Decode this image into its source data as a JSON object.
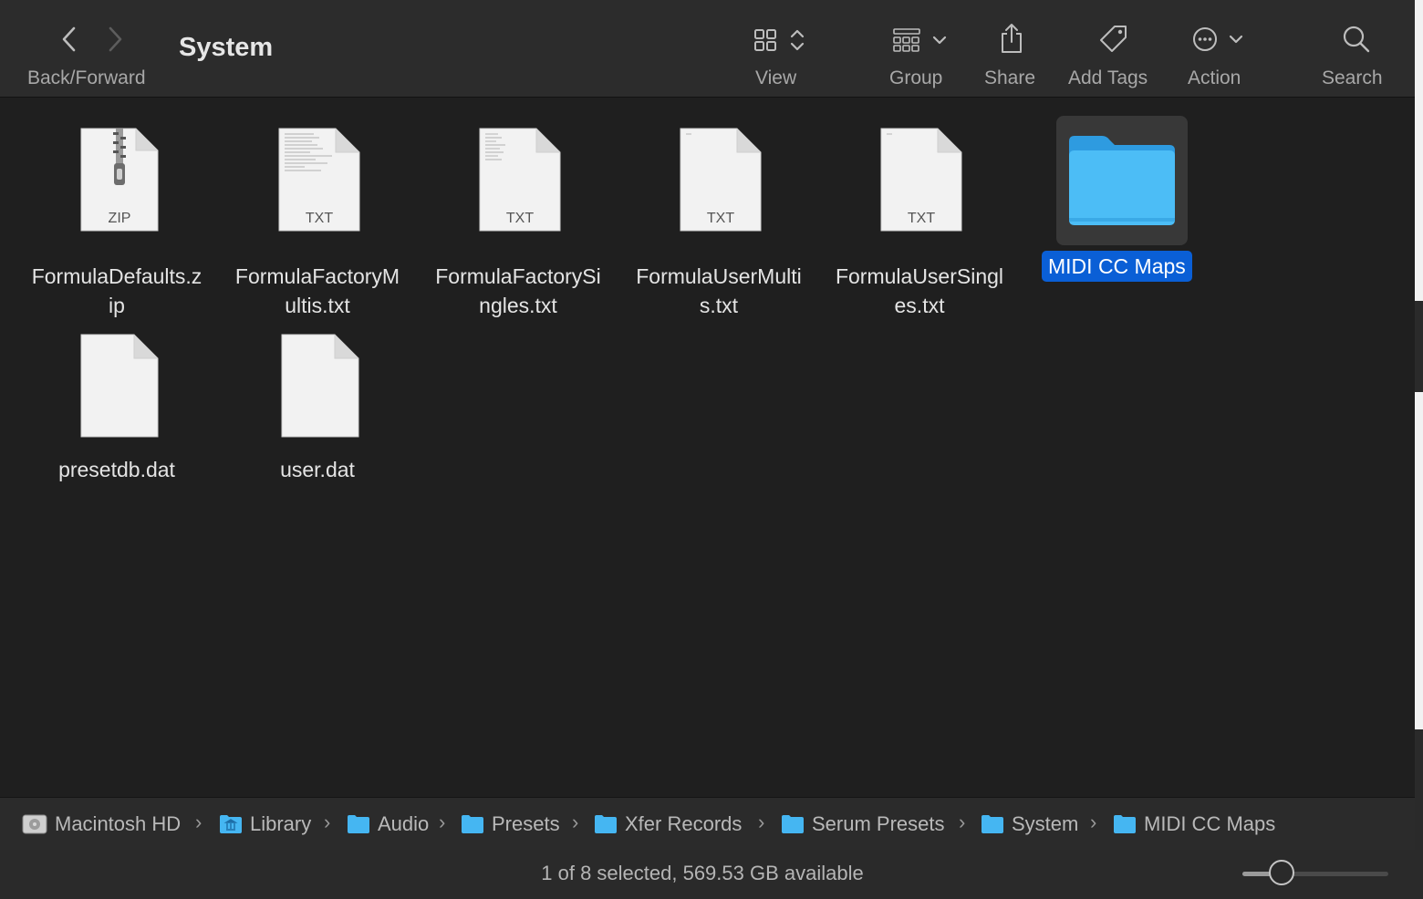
{
  "window": {
    "title": "System"
  },
  "toolbar": {
    "back_forward_label": "Back/Forward",
    "view_label": "View",
    "group_label": "Group",
    "share_label": "Share",
    "add_tags_label": "Add Tags",
    "action_label": "Action",
    "search_label": "Search"
  },
  "files": [
    {
      "name_line1": "FormulaDefaults.z",
      "name_line2": "ip",
      "badge": "ZIP"
    },
    {
      "name_line1": "FormulaFactoryM",
      "name_line2": "ultis.txt",
      "badge": "TXT"
    },
    {
      "name_line1": "FormulaFactorySi",
      "name_line2": "ngles.txt",
      "badge": "TXT"
    },
    {
      "name_line1": "FormulaUserMulti",
      "name_line2": "s.txt",
      "badge": "TXT"
    },
    {
      "name_line1": "FormulaUserSingl",
      "name_line2": "es.txt",
      "badge": "TXT"
    },
    {
      "name_line1": "MIDI CC Maps",
      "name_line2": "",
      "badge": ""
    },
    {
      "name_line1": "presetdb.dat",
      "name_line2": "",
      "badge": ""
    },
    {
      "name_line1": "user.dat",
      "name_line2": "",
      "badge": ""
    }
  ],
  "selected_item": "MIDI CC Maps",
  "pathbar": [
    "Macintosh HD",
    "Library",
    "Audio",
    "Presets",
    "Xfer Records",
    "Serum Presets",
    "System",
    "MIDI CC Maps"
  ],
  "pathbar_separator": "›",
  "status": {
    "text": "1 of 8 selected, 569.53 GB available",
    "icon_size_fraction": 0.27
  },
  "colors": {
    "selection": "#0a5fd6",
    "folder": "#3fb0f0",
    "background": "#1f1f1f"
  }
}
